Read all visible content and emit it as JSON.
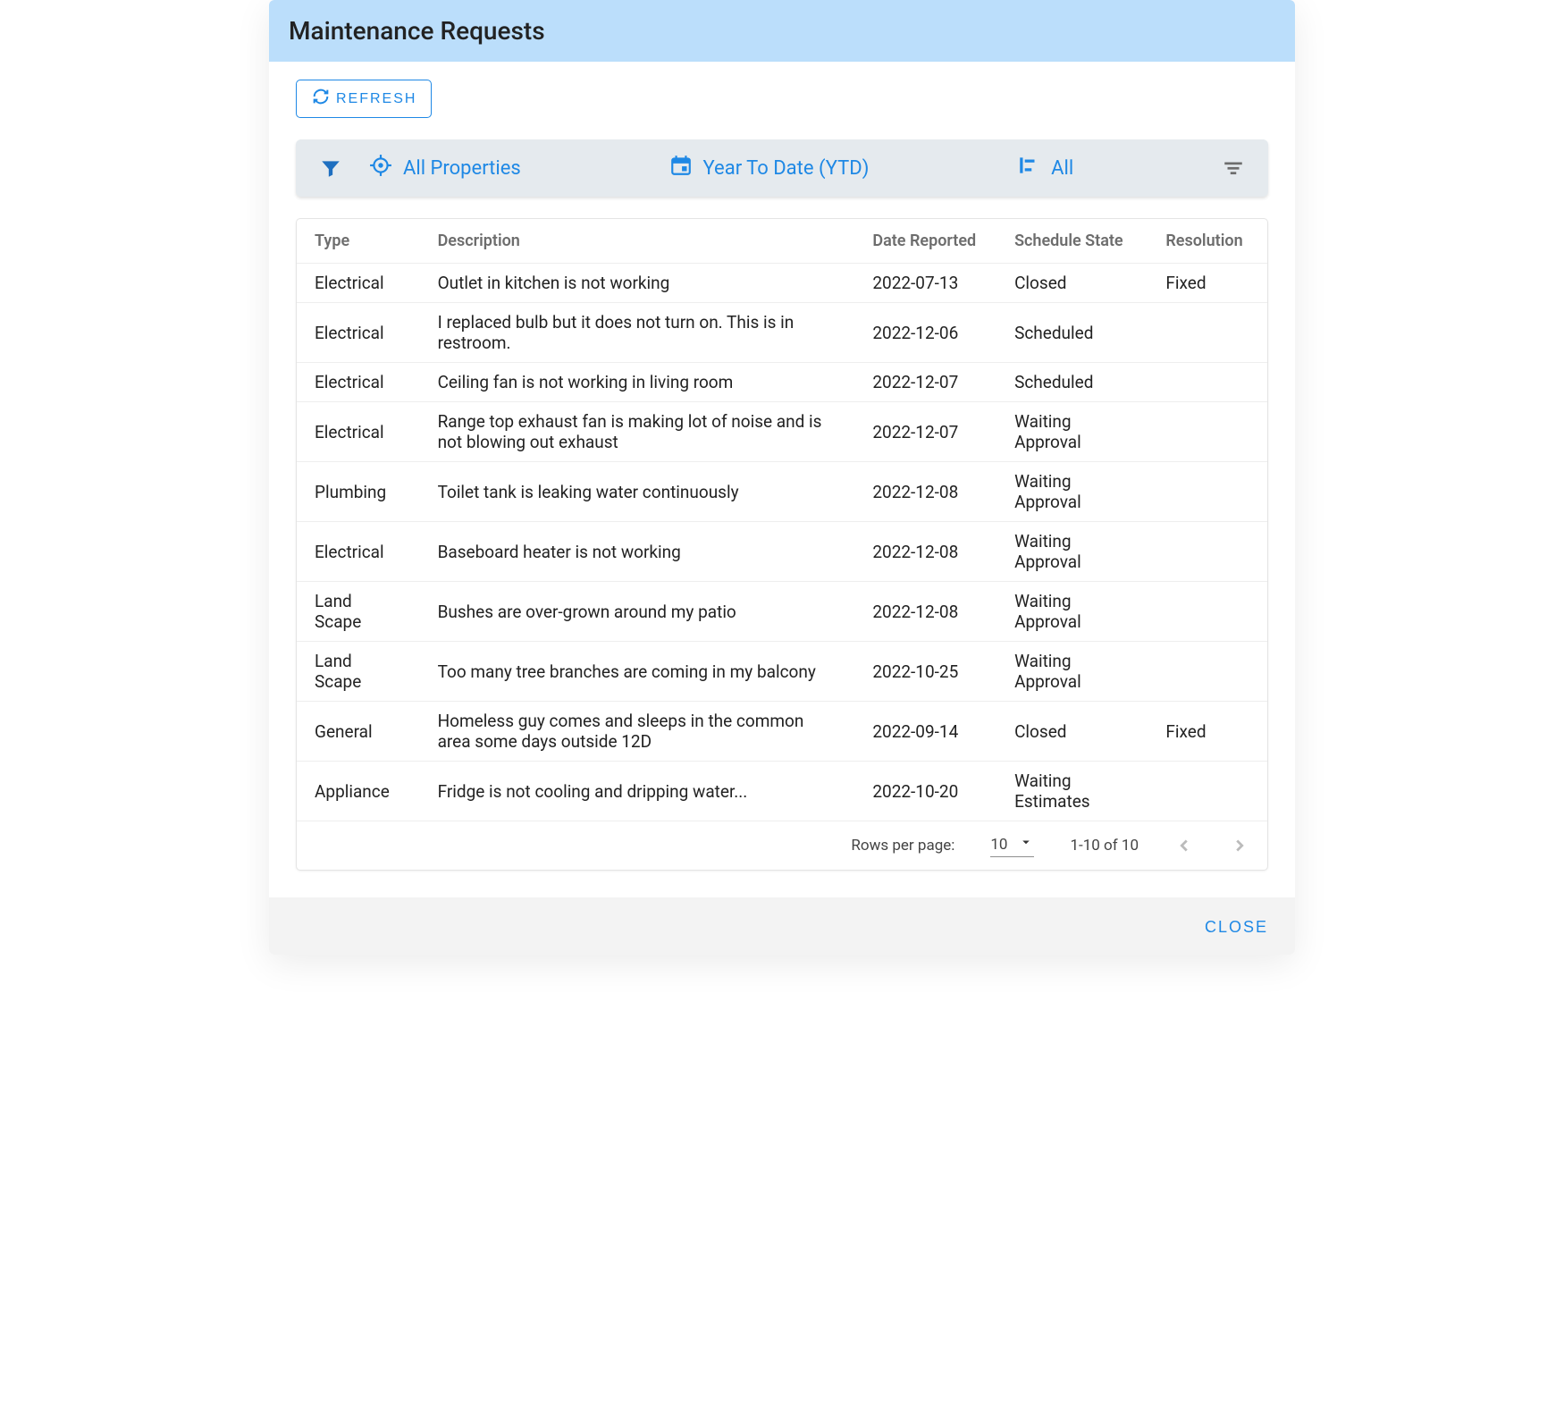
{
  "header": {
    "title": "Maintenance Requests"
  },
  "actions": {
    "refresh_label": "REFRESH",
    "close_label": "CLOSE"
  },
  "filters": {
    "properties_label": "All Properties",
    "date_range_label": "Year To Date (YTD)",
    "state_label": "All"
  },
  "table": {
    "columns": {
      "type": "Type",
      "description": "Description",
      "date_reported": "Date Reported",
      "schedule_state": "Schedule State",
      "resolution": "Resolution"
    },
    "rows": [
      {
        "type": "Electrical",
        "description": "Outlet in kitchen is not working",
        "date": "2022-07-13",
        "state": "Closed",
        "resolution": "Fixed"
      },
      {
        "type": "Electrical",
        "description": "I replaced bulb but it does not turn on. This is in restroom.",
        "date": "2022-12-06",
        "state": "Scheduled",
        "resolution": ""
      },
      {
        "type": "Electrical",
        "description": "Ceiling fan is not working in living room",
        "date": "2022-12-07",
        "state": "Scheduled",
        "resolution": ""
      },
      {
        "type": "Electrical",
        "description": "Range top exhaust fan is making lot of noise and is not blowing out exhaust",
        "date": "2022-12-07",
        "state": "Waiting Approval",
        "resolution": ""
      },
      {
        "type": "Plumbing",
        "description": "Toilet tank is leaking water continuously",
        "date": "2022-12-08",
        "state": "Waiting Approval",
        "resolution": ""
      },
      {
        "type": "Electrical",
        "description": "Baseboard heater is not working",
        "date": "2022-12-08",
        "state": "Waiting Approval",
        "resolution": ""
      },
      {
        "type": "Land Scape",
        "description": "Bushes are over-grown around my patio",
        "date": "2022-12-08",
        "state": "Waiting Approval",
        "resolution": ""
      },
      {
        "type": "Land Scape",
        "description": "Too many tree branches are coming in my balcony",
        "date": "2022-10-25",
        "state": "Waiting Approval",
        "resolution": ""
      },
      {
        "type": "General",
        "description": "Homeless guy comes and sleeps in the common area some days outside 12D",
        "date": "2022-09-14",
        "state": "Closed",
        "resolution": "Fixed"
      },
      {
        "type": "Appliance",
        "description": "Fridge is not cooling and dripping water...",
        "date": "2022-10-20",
        "state": "Waiting Estimates",
        "resolution": ""
      }
    ]
  },
  "pagination": {
    "rows_per_page_label": "Rows per page:",
    "rows_per_page_value": "10",
    "range_label": "1-10 of 10"
  }
}
